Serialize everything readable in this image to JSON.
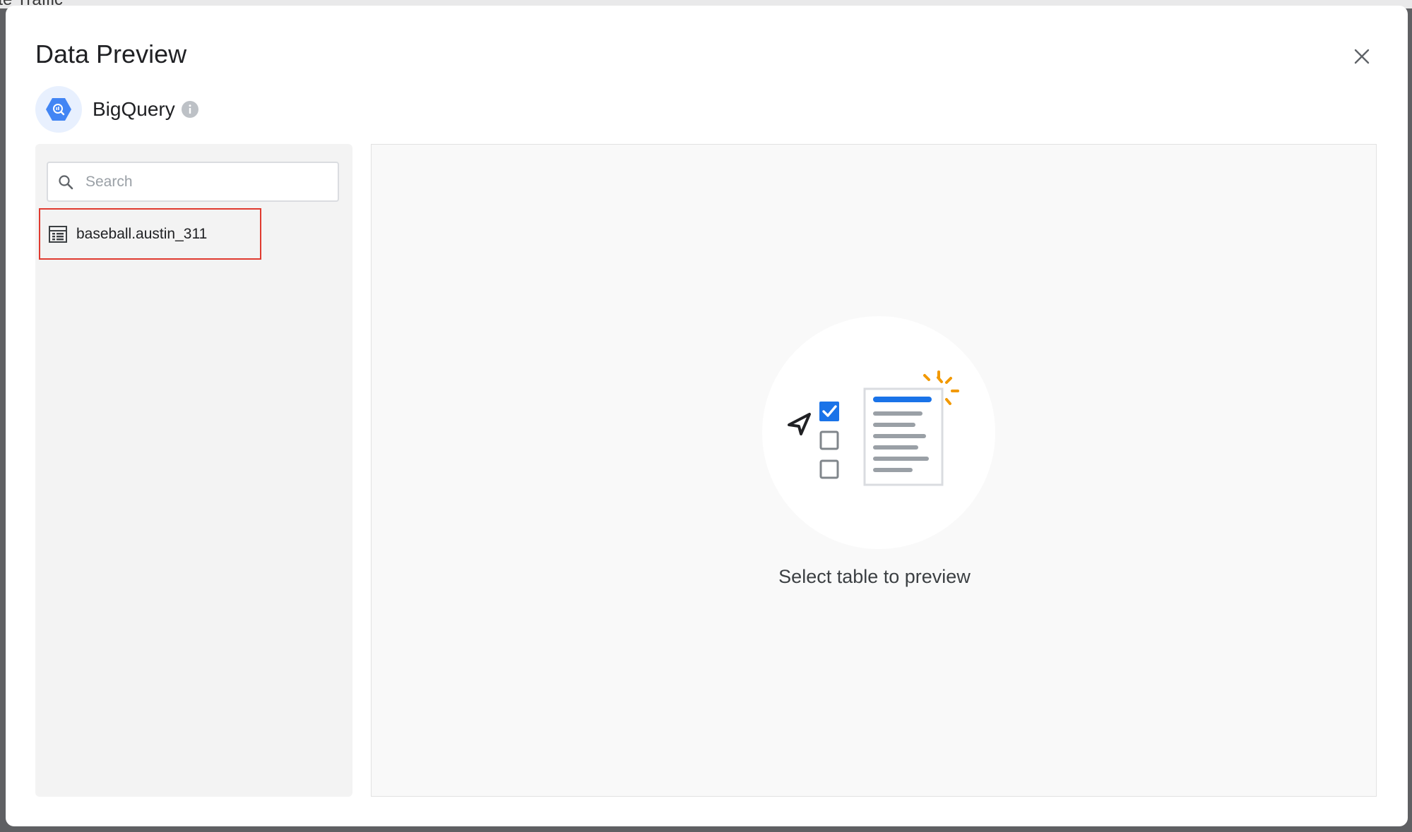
{
  "background": {
    "window_title_fragment": "ite Traffic"
  },
  "dialog": {
    "title": "Data Preview",
    "close_icon": "close-icon"
  },
  "source": {
    "name": "BigQuery",
    "logo_icon": "bigquery-logo-icon",
    "info_icon": "info-icon"
  },
  "search": {
    "placeholder": "Search",
    "value": "",
    "icon": "search-icon"
  },
  "tables": [
    {
      "label": "baseball.austin_311",
      "icon": "table-icon",
      "highlighted": true
    }
  ],
  "preview": {
    "empty_message": "Select table to preview",
    "illustration": "select-table-illustration"
  },
  "colors": {
    "accent": "#1a73e8",
    "highlight_border": "#e03a2f",
    "spark": "#f29900",
    "left_panel_bg": "#f3f3f3",
    "preview_bg": "#f9f9f9"
  }
}
